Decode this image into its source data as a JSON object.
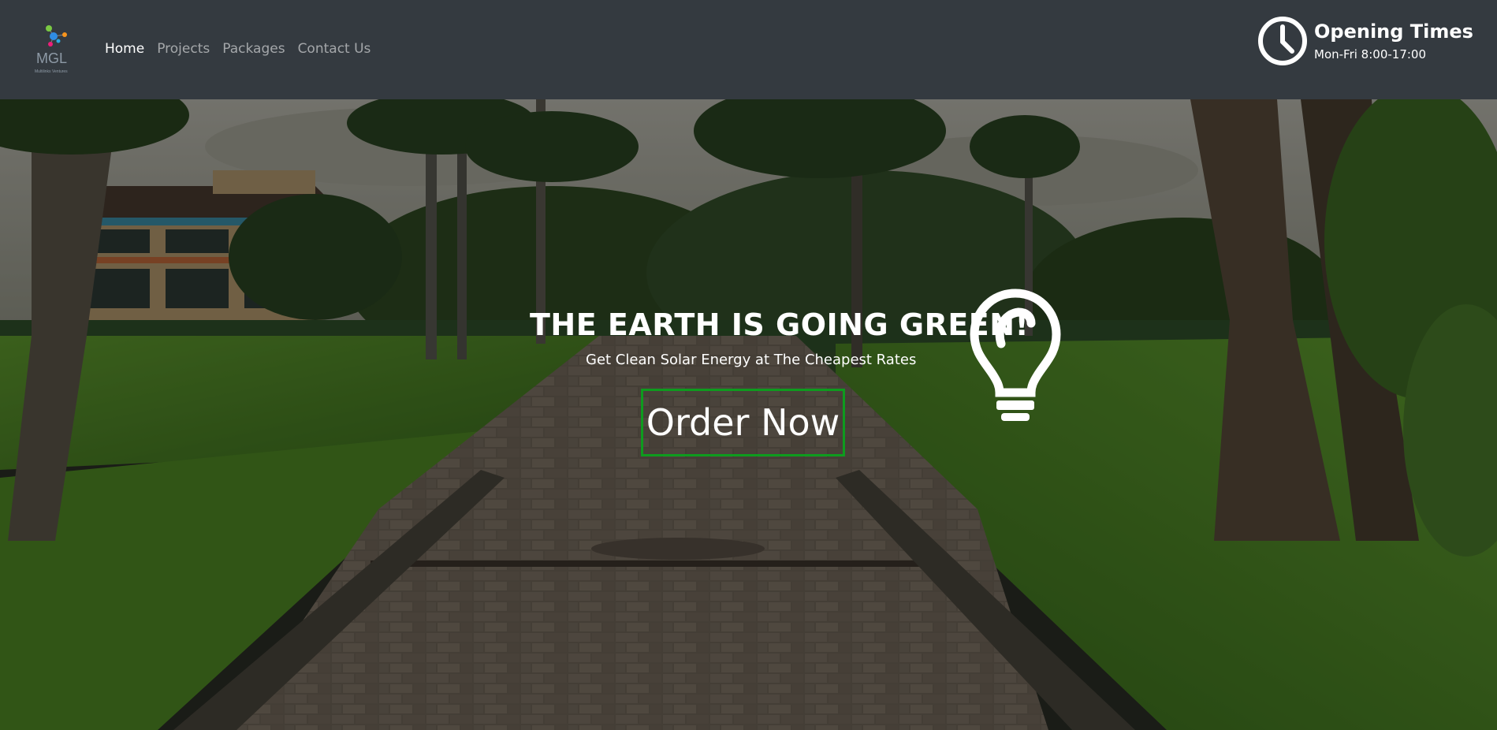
{
  "nav": {
    "brand": {
      "logo_text": "MGL",
      "tagline": "Multilinks Ventures"
    },
    "links": [
      {
        "label": "Home",
        "active": true
      },
      {
        "label": "Projects",
        "active": false
      },
      {
        "label": "Packages",
        "active": false
      },
      {
        "label": "Contact Us",
        "active": false
      }
    ],
    "opening": {
      "icon": "clock-icon",
      "title": "Opening Times",
      "hours": "Mon-Fri 8:00-17:00"
    }
  },
  "hero": {
    "title": "THE EARTH IS GOING GREEN!",
    "subtitle": "Get Clean Solar Energy at The Cheapest Rates",
    "cta_label": "Order Now",
    "cta_border_color": "#0e9b1e",
    "icon": "lightbulb-icon",
    "background": "garden-path-with-palm-trees"
  },
  "colors": {
    "navbar": "#343a40",
    "text": "#ffffff",
    "accent": "#0e9b1e"
  }
}
